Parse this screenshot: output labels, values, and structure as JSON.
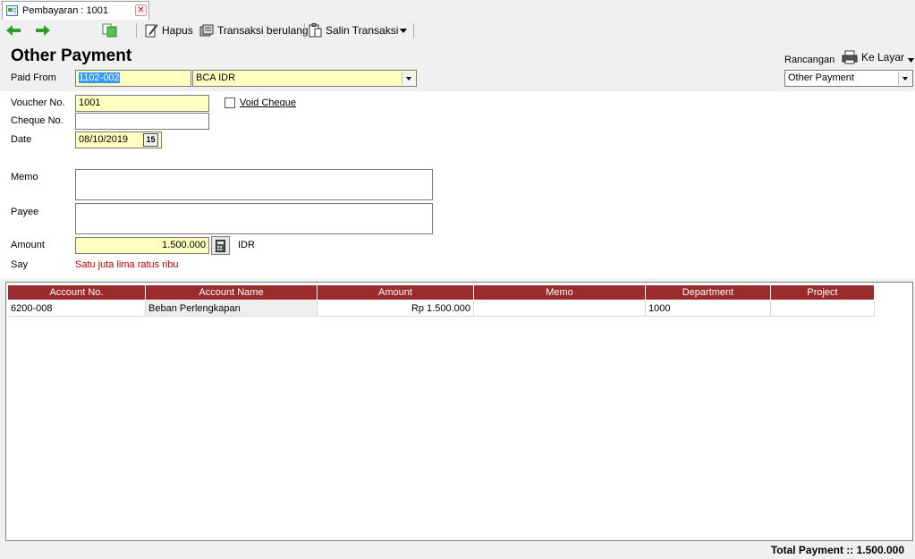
{
  "tab": {
    "label": "Pembayaran : 1001",
    "close": "✕"
  },
  "toolbar": {
    "delete_label": "Hapus",
    "recurring_label": "Transaksi berulang",
    "copy_label": "Salin Transaksi"
  },
  "header": {
    "title": "Other Payment",
    "paid_from_label": "Paid From",
    "paid_from_code": "1102-002",
    "paid_from_name": "BCA IDR",
    "design_label": "Rancangan",
    "print_label": "Ke Layar",
    "template_value": "Other Payment"
  },
  "form": {
    "voucher_label": "Voucher No.",
    "voucher_value": "1001",
    "void_cheque_label": "Void Cheque",
    "void_cheque_checked": false,
    "cheque_label": "Cheque No.",
    "cheque_value": "",
    "date_label": "Date",
    "date_value": "08/10/2019",
    "calendar_glyph": "15",
    "memo_label": "Memo",
    "memo_value": "",
    "payee_label": "Payee",
    "payee_value": "",
    "amount_label": "Amount",
    "amount_value": "1.500.000",
    "currency": "IDR",
    "say_label": "Say",
    "say_value": "Satu juta lima ratus ribu"
  },
  "grid": {
    "columns": [
      "Account No.",
      "Account Name",
      "Amount",
      "Memo",
      "Department",
      "Project"
    ],
    "rows": [
      {
        "account_no": "6200-008",
        "account_name": "Beban Perlengkapan",
        "amount": "Rp 1.500.000",
        "memo": "",
        "department": "1000",
        "project": ""
      }
    ]
  },
  "footer": {
    "total": "Total Payment :: 1.500.000"
  },
  "colors": {
    "grid_header": "#9b2b2d",
    "input_yellow": "#ffffc0",
    "say_text": "#c00000",
    "arrow_green": "#2e9e2e"
  }
}
